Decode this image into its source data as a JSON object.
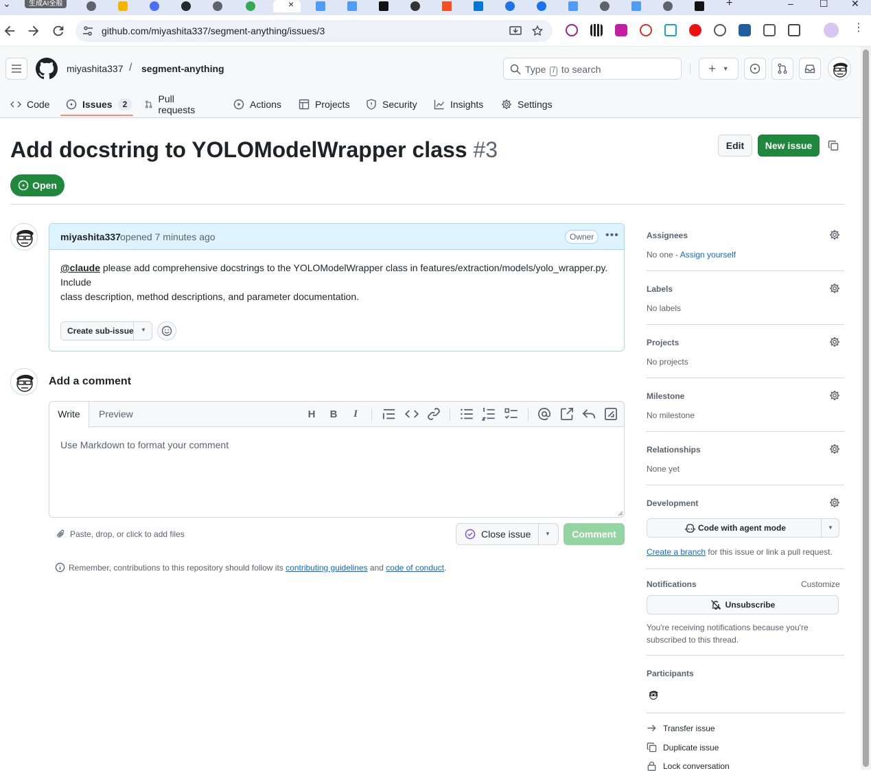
{
  "browser": {
    "first_tab_label": "生成AI全般",
    "url": "github.com/miyashita337/segment-anything/issues/3"
  },
  "header": {
    "owner": "miyashita337",
    "separator": "/",
    "repo": "segment-anything",
    "search_placeholder_pre": "Type",
    "search_key": "/",
    "search_placeholder_post": "to search"
  },
  "repo_nav": {
    "code": "Code",
    "issues": "Issues",
    "issues_count": "2",
    "pull_requests": "Pull requests",
    "actions": "Actions",
    "projects": "Projects",
    "security": "Security",
    "insights": "Insights",
    "settings": "Settings"
  },
  "issue": {
    "title": "Add docstring to YOLOModelWrapper class",
    "number": "#3",
    "edit_label": "Edit",
    "new_issue_label": "New issue",
    "state": "Open"
  },
  "comment": {
    "author": "miyashita337",
    "meta": "opened 7 minutes ago",
    "badge": "Owner",
    "mention": "@claude",
    "line1_rest": " please add comprehensive docstrings to the YOLOModelWrapper class in features/extraction/models/yolo_wrapper.py.",
    "line2": "Include",
    "line3": "class description, method descriptions, and parameter documentation.",
    "sub_issue_label": "Create sub-issue"
  },
  "add_comment": {
    "title": "Add a comment",
    "write_tab": "Write",
    "preview_tab": "Preview",
    "placeholder": "Use Markdown to format your comment",
    "attach_hint": "Paste, drop, or click to add files",
    "close_issue_label": "Close issue",
    "comment_label": "Comment",
    "notice_pre": "Remember, contributions to this repository should follow its ",
    "notice_link1": "contributing guidelines",
    "notice_mid": " and ",
    "notice_link2": "code of conduct",
    "notice_end": "."
  },
  "sidebar": {
    "assignees": {
      "title": "Assignees",
      "value": "No one - ",
      "link": "Assign yourself"
    },
    "labels": {
      "title": "Labels",
      "value": "No labels"
    },
    "projects": {
      "title": "Projects",
      "value": "No projects"
    },
    "milestone": {
      "title": "Milestone",
      "value": "No milestone"
    },
    "relationships": {
      "title": "Relationships",
      "value": "None yet"
    },
    "development": {
      "title": "Development",
      "agent_button": "Code with agent mode",
      "create_branch": "Create a branch",
      "branch_rest": " for this issue or link a pull request."
    },
    "notifications": {
      "title": "Notifications",
      "customize": "Customize",
      "unsubscribe": "Unsubscribe",
      "reason": "You're receiving notifications because you're subscribed to this thread."
    },
    "participants": {
      "title": "Participants"
    },
    "actions": {
      "transfer": "Transfer issue",
      "duplicate": "Duplicate issue",
      "lock": "Lock conversation"
    }
  },
  "colors": {
    "green": "#1f883d",
    "link": "#0969da",
    "muted": "#59636e",
    "comment_header": "#ddf4ff",
    "underline": "#fd8c73"
  }
}
